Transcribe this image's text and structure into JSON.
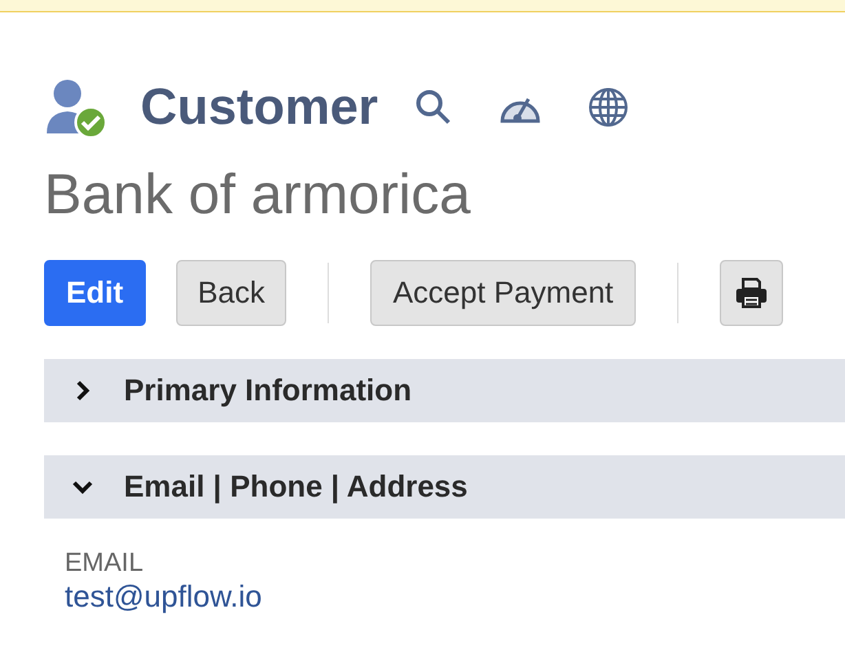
{
  "header": {
    "title": "Customer",
    "verified": true
  },
  "record_name": "Bank of armorica",
  "buttons": [
    {
      "label": "Edit",
      "kind": "primary"
    },
    {
      "label": "Back",
      "kind": "default"
    },
    {
      "label": "Accept Payment",
      "kind": "default"
    }
  ],
  "sections": [
    {
      "title": "Primary Information",
      "expanded": false
    },
    {
      "title": "Email | Phone | Address",
      "expanded": true,
      "fields": [
        {
          "label": "EMAIL",
          "value": "test@upflow.io"
        }
      ]
    }
  ]
}
